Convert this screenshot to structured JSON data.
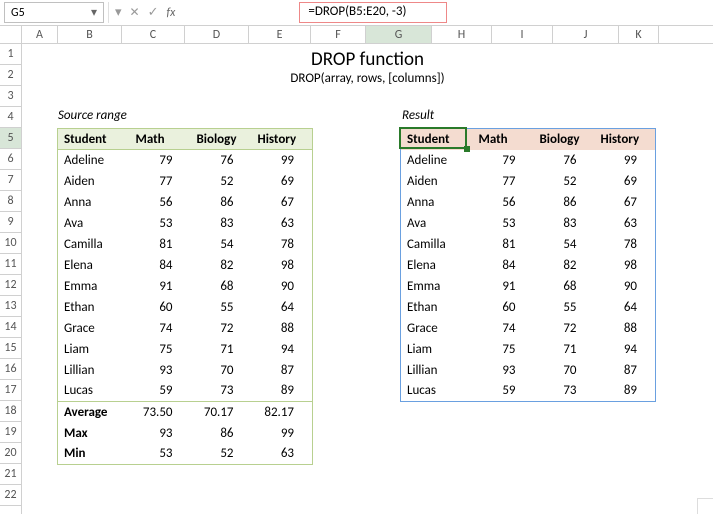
{
  "nameBox": "G5",
  "formula": "=DROP(B5:E20, -3)",
  "fxLabel": "fx",
  "title": "DROP function",
  "subtitle": "DROP(array, rows, [columns])",
  "sourceLabel": "Source range",
  "resultLabel": "Result",
  "columns": [
    "A",
    "B",
    "C",
    "D",
    "E",
    "F",
    "G",
    "H",
    "I",
    "J",
    "K"
  ],
  "activeCol": "G",
  "rows": [
    "1",
    "2",
    "3",
    "4",
    "5",
    "6",
    "7",
    "8",
    "9",
    "10",
    "11",
    "12",
    "13",
    "14",
    "15",
    "16",
    "17",
    "18",
    "19",
    "20",
    "21",
    "22"
  ],
  "activeRow": "5",
  "headers": [
    "Student",
    "Math",
    "Biology",
    "History"
  ],
  "data": [
    [
      "Adeline",
      "79",
      "76",
      "99"
    ],
    [
      "Aiden",
      "77",
      "52",
      "69"
    ],
    [
      "Anna",
      "56",
      "86",
      "67"
    ],
    [
      "Ava",
      "53",
      "83",
      "63"
    ],
    [
      "Camilla",
      "81",
      "54",
      "78"
    ],
    [
      "Elena",
      "84",
      "82",
      "98"
    ],
    [
      "Emma",
      "91",
      "68",
      "90"
    ],
    [
      "Ethan",
      "60",
      "55",
      "64"
    ],
    [
      "Grace",
      "74",
      "72",
      "88"
    ],
    [
      "Liam",
      "75",
      "71",
      "94"
    ],
    [
      "Lillian",
      "93",
      "70",
      "87"
    ],
    [
      "Lucas",
      "59",
      "73",
      "89"
    ]
  ],
  "stats": [
    [
      "Average",
      "73.50",
      "70.17",
      "82.17"
    ],
    [
      "Max",
      "93",
      "86",
      "99"
    ],
    [
      "Min",
      "53",
      "52",
      "63"
    ]
  ],
  "chart_data": {
    "type": "table",
    "title": "DROP function",
    "categories": [
      "Student",
      "Math",
      "Biology",
      "History"
    ],
    "series": [
      {
        "name": "Adeline",
        "values": [
          79,
          76,
          99
        ]
      },
      {
        "name": "Aiden",
        "values": [
          77,
          52,
          69
        ]
      },
      {
        "name": "Anna",
        "values": [
          56,
          86,
          67
        ]
      },
      {
        "name": "Ava",
        "values": [
          53,
          83,
          63
        ]
      },
      {
        "name": "Camilla",
        "values": [
          81,
          54,
          78
        ]
      },
      {
        "name": "Elena",
        "values": [
          84,
          82,
          98
        ]
      },
      {
        "name": "Emma",
        "values": [
          91,
          68,
          90
        ]
      },
      {
        "name": "Ethan",
        "values": [
          60,
          55,
          64
        ]
      },
      {
        "name": "Grace",
        "values": [
          74,
          72,
          88
        ]
      },
      {
        "name": "Liam",
        "values": [
          75,
          71,
          94
        ]
      },
      {
        "name": "Lillian",
        "values": [
          93,
          70,
          87
        ]
      },
      {
        "name": "Lucas",
        "values": [
          59,
          73,
          89
        ]
      }
    ],
    "summary": {
      "Average": [
        73.5,
        70.17,
        82.17
      ],
      "Max": [
        93,
        86,
        99
      ],
      "Min": [
        53,
        52,
        63
      ]
    }
  }
}
